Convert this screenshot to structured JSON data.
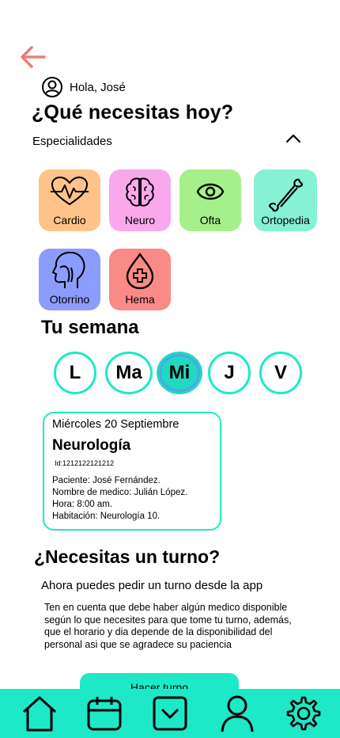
{
  "header": {
    "greeting": "Hola, José",
    "title": "¿Qué necesitas hoy?"
  },
  "specialties": {
    "label": "Especialidades",
    "items": [
      {
        "label": "Cardio",
        "color": "#ffc38a",
        "icon": "heart-pulse-icon"
      },
      {
        "label": "Neuro",
        "color": "#f9a8ec",
        "icon": "brain-icon"
      },
      {
        "label": "Ofta",
        "color": "#a6f08c",
        "icon": "eye-icon"
      },
      {
        "label": "Ortopedia",
        "color": "#86f1d3",
        "icon": "bone-icon"
      },
      {
        "label": "Otorrino",
        "color": "#8b9cff",
        "icon": "head-throat-icon"
      },
      {
        "label": "Hema",
        "color": "#f98a86",
        "icon": "blood-drop-icon"
      }
    ]
  },
  "week": {
    "title": "Tu semana",
    "days": [
      "L",
      "Ma",
      "Mi",
      "J",
      "V"
    ],
    "selected": "Mi"
  },
  "appointment": {
    "date": "Miércoles 20 Septiembre",
    "specialty": "Neurología",
    "id": "Id:1212122121212",
    "patient": "Paciente: José Fernández.",
    "doctor": "Nombre de medico: Julián López.",
    "time": "Hora: 8:00 am.",
    "room": "Habitación: Neurología 10."
  },
  "booking": {
    "title": "¿Necesitas un turno?",
    "subtitle": "Ahora puedes pedir un turno desde la app",
    "note": "Ten en cuenta que debe haber algún medico disponible según lo que necesites para que tome tu turno, además, que el horario y dia depende de la disponibilidad del personal asi que se agradece su paciencia",
    "button": "Hacer turno"
  },
  "colors": {
    "accent": "#1de9c8",
    "back_arrow": "#f07b79"
  }
}
